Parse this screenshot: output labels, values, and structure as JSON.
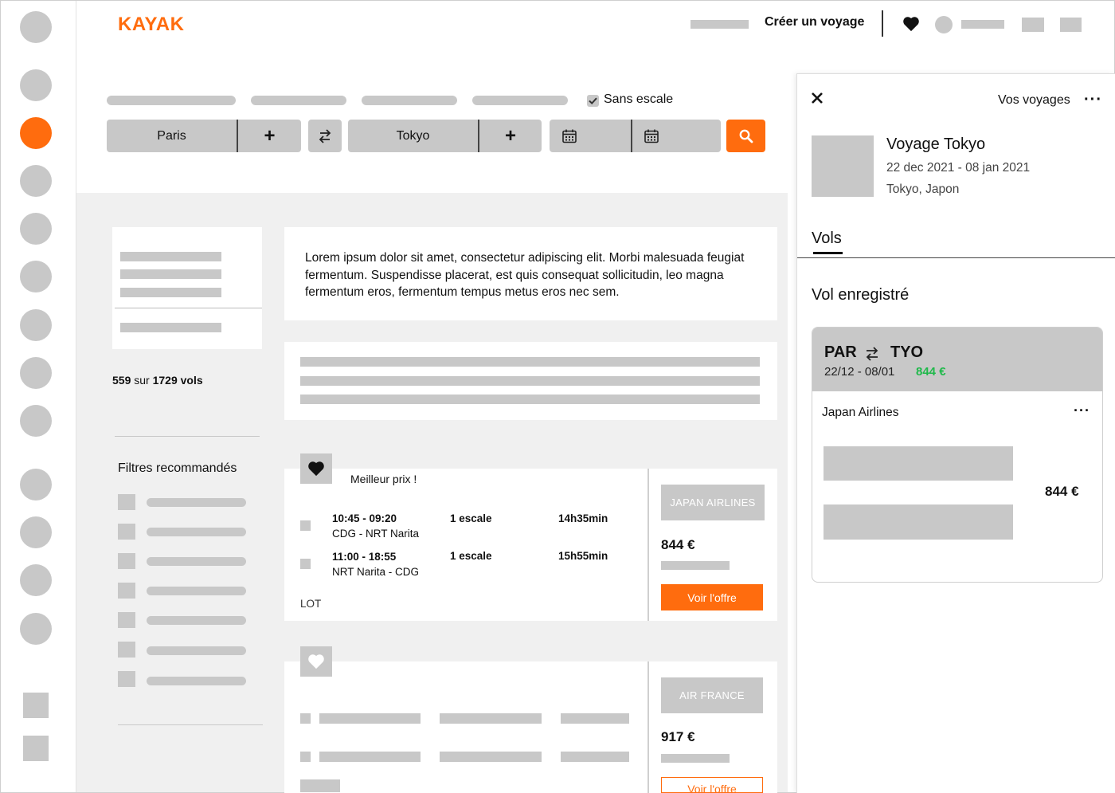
{
  "header": {
    "logo": "KAYAK",
    "create_trip": "Créer un voyage"
  },
  "search": {
    "nonstop_label": "Sans escale",
    "nonstop_checked": true,
    "origin": "Paris",
    "destination": "Tokyo",
    "add_symbol": "+",
    "swap_icon": "swap-icon",
    "calendar_icon": "calendar-icon",
    "search_icon": "search-icon"
  },
  "intro": {
    "text": "Lorem ipsum dolor sit amet, consectetur adipiscing elit. Morbi malesuada feugiat fermentum. Suspendisse placerat, est quis consequat sollicitudin, leo magna fermentum eros, fermentum tempus metus eros nec sem."
  },
  "results": {
    "shown": "559",
    "sur": "sur",
    "total": "1729 vols",
    "filters_title": "Filtres recommandés"
  },
  "flights": [
    {
      "badge": "Meilleur prix !",
      "favorited": true,
      "legs": [
        {
          "times": "10:45 - 09:20",
          "route": "CDG - NRT Narita",
          "stops": "1 escale",
          "duration": "14h35min"
        },
        {
          "times": "11:00 - 18:55",
          "route": "NRT Narita - CDG",
          "stops": "1 escale",
          "duration": "15h55min"
        }
      ],
      "operator": "LOT",
      "airline": "JAPAN AIRLINES",
      "price": "844 €",
      "cta": "Voir l'offre"
    },
    {
      "favorited": false,
      "airline": "AIR FRANCE",
      "price": "917 €",
      "cta": "Voir l'offre"
    }
  ],
  "panel": {
    "close_icon": "close-icon",
    "title": "Vos voyages",
    "trip_name": "Voyage Tokyo",
    "trip_dates": "22 dec 2021 - 08 jan 2021",
    "trip_place": "Tokyo, Japon",
    "tab": "Vols",
    "section_title": "Vol enregistré",
    "saved": {
      "from": "PAR",
      "to": "TYO",
      "dates": "22/12 - 08/01",
      "price_green": "844 €",
      "airline": "Japan Airlines",
      "price": "844 €"
    }
  },
  "colors": {
    "accent": "#ff6c0e",
    "placeholder": "#c8c8c8",
    "price_green": "#1fb94a"
  }
}
